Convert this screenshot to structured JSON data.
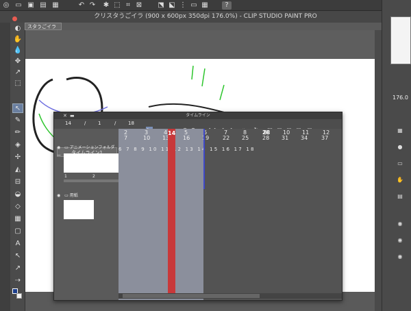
{
  "window": {
    "title": "クリスタうごイラ (900 x 600px 350dpi 176.0%) - CLIP STUDIO PAINT PRO",
    "document_tab": "スタうごイラ"
  },
  "topbar": {
    "icons": [
      "menu-icon",
      "new-file-icon",
      "open-folder-icon",
      "save-icon",
      "undo-icon",
      "redo-icon",
      "clear-icon",
      "transform-icon",
      "select-icon",
      "deselect-icon",
      "invert-icon",
      "crop-icon",
      "grid-icon",
      "search-icon",
      "help-icon"
    ]
  },
  "tools": [
    "navigator-icon",
    "hand-icon",
    "eyedrop-icon",
    "arrow-icon",
    "pen-icon",
    "marquee-icon",
    "lasso-icon",
    "brush-icon",
    "pencil-icon",
    "airbrush-icon",
    "decoration-icon",
    "eraser-icon",
    "fill-icon",
    "gradient-icon",
    "figure-icon",
    "text-icon",
    "correction-icon",
    "blend-icon",
    "color-swatch"
  ],
  "right_panel": {
    "zoom_value": "176.0"
  },
  "timeline": {
    "title": "タイムライン",
    "toolbar_numbers": [
      "14",
      "/",
      "1",
      "/",
      "18"
    ],
    "name": "タイムライン1",
    "current_frame": "14",
    "frame_header_top": [
      "2",
      "3",
      "4",
      "5",
      "6",
      "7",
      "8",
      "9",
      "10",
      "11",
      "12"
    ],
    "frame_header_bottom": [
      "7",
      "10",
      "13",
      "16",
      "19",
      "22",
      "25",
      "28",
      "31",
      "34",
      "37"
    ],
    "frame_highlight": "28",
    "cell_numbers": [
      "6",
      "7",
      "8",
      "9",
      "10",
      "11",
      "12",
      "13",
      "14",
      "15",
      "16",
      "17",
      "18"
    ],
    "layers": [
      {
        "name": "アニメーションフォルダー",
        "cel_labels": [
          "1",
          "2"
        ]
      },
      {
        "name": "用紙"
      }
    ]
  }
}
